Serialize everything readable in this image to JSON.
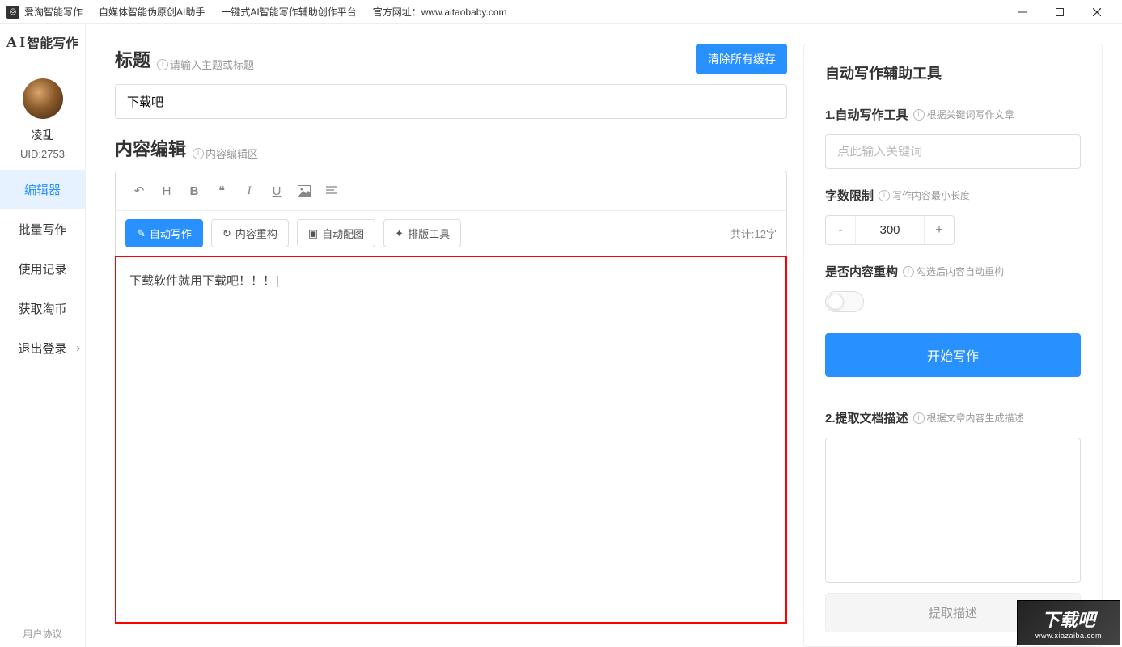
{
  "titlebar": {
    "app_name": "爱淘智能写作",
    "subtitle1": "自媒体智能伪原创AI助手",
    "subtitle2": "一键式AI智能写作辅助创作平台",
    "website_label": "官方网址：www.aitaobaby.com"
  },
  "sidebar": {
    "logo_text": "智能写作",
    "logo_prefix": "A I",
    "username": "凌乱",
    "uid": "UID:2753",
    "items": [
      "编辑器",
      "批量写作",
      "使用记录",
      "获取淘币",
      "退出登录"
    ],
    "footer": "用户协议"
  },
  "editor": {
    "title_label": "标题",
    "title_hint": "请输入主题或标题",
    "clear_cache": "清除所有缓存",
    "title_value": "下载吧",
    "content_label": "内容编辑",
    "content_hint": "内容编辑区",
    "actions": {
      "auto_write": "自动写作",
      "rebuild": "内容重构",
      "auto_image": "自动配图",
      "layout": "排版工具"
    },
    "word_count": "共计:12字",
    "content_text": "下载软件就用下载吧！！！"
  },
  "right": {
    "panel_title": "自动写作辅助工具",
    "s1_title": "1.自动写作工具",
    "s1_hint": "根据关键词写作文章",
    "keyword_placeholder": "点此输入关键词",
    "s2_title": "字数限制",
    "s2_hint": "写作内容最小长度",
    "word_limit": "300",
    "s3_title": "是否内容重构",
    "s3_hint": "勾选后内容自动重构",
    "start_btn": "开始写作",
    "s4_title": "2.提取文档描述",
    "s4_hint": "根据文章内容生成描述",
    "extract_btn": "提取描述"
  },
  "watermark": {
    "main": "下载吧",
    "sub": "www.xiazaiba.com"
  }
}
